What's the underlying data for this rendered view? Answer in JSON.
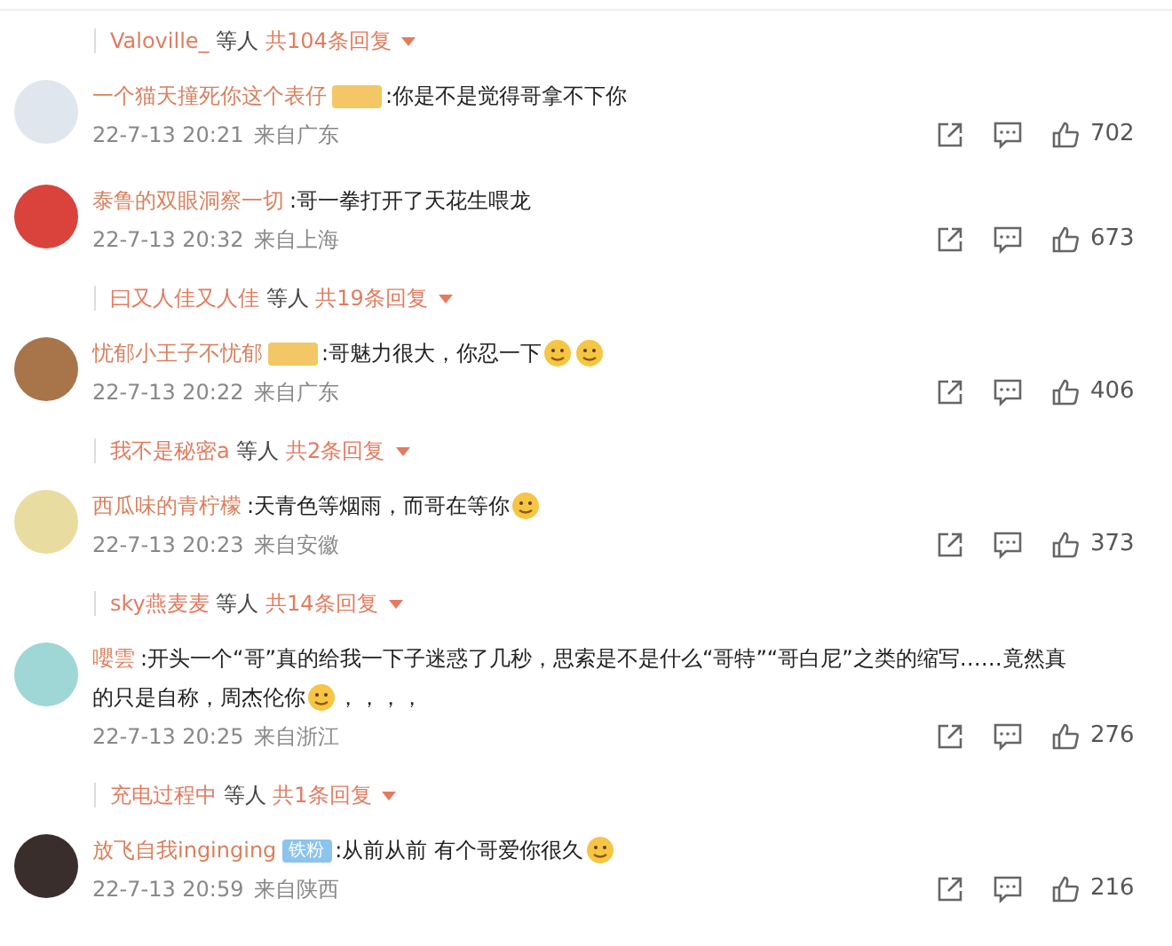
{
  "items": [
    {
      "kind": "reply_summary",
      "user": "Valoville_",
      "others": "等人",
      "count": "共104条回复"
    },
    {
      "kind": "comment",
      "avatar": {
        "color": "#dfe6ee"
      },
      "user": "一个猫天撞死你这个表仔",
      "badge": {
        "color": "#f3c766"
      },
      "content": [
        {
          "kind": "text",
          "text": ":你是不是觉得哥拿不下你"
        }
      ],
      "time": "22-7-13 20:21",
      "location": "来自广东",
      "likes": "702"
    },
    {
      "kind": "comment",
      "avatar": {
        "color": "#d9433b"
      },
      "user": "泰鲁的双眼洞察一切",
      "content": [
        {
          "kind": "text",
          "text": ":哥一拳打开了天花生喂龙"
        }
      ],
      "time": "22-7-13 20:32",
      "location": "来自上海",
      "likes": "673"
    },
    {
      "kind": "reply_summary",
      "user": "曰又人佳又人佳",
      "others": "等人",
      "count": "共19条回复"
    },
    {
      "kind": "comment",
      "avatar": {
        "color": "#a8744a"
      },
      "user": "忧郁小王子不忧郁",
      "badge": {
        "color": "#f3c766"
      },
      "content": [
        {
          "kind": "text",
          "text": ":哥魅力很大，你忍一下"
        },
        {
          "kind": "emoji"
        },
        {
          "kind": "emoji"
        }
      ],
      "time": "22-7-13 20:22",
      "location": "来自广东",
      "likes": "406"
    },
    {
      "kind": "reply_summary",
      "user": "我不是秘密a",
      "others": "等人",
      "count": "共2条回复"
    },
    {
      "kind": "comment",
      "avatar": {
        "color": "#e9dca0"
      },
      "user": "西瓜味的青柠檬",
      "content": [
        {
          "kind": "text",
          "text": ":天青色等烟雨，而哥在等你"
        },
        {
          "kind": "emoji"
        }
      ],
      "time": "22-7-13 20:23",
      "location": "来自安徽",
      "likes": "373"
    },
    {
      "kind": "reply_summary",
      "user": "sky燕麦麦",
      "others": "等人",
      "count": "共14条回复"
    },
    {
      "kind": "comment",
      "avatar": {
        "color": "#9fd6d6"
      },
      "user": "嚶雲",
      "content": [
        {
          "kind": "text",
          "text": ":开头一个“哥”真的给我一下子迷惑了几秒，思索是不是什么“哥特”“哥白尼”之类的缩写……竟然真"
        },
        {
          "kind": "text",
          "text": "的只是自称，周杰伦你"
        },
        {
          "kind": "emoji"
        },
        {
          "kind": "text",
          "text": "，，，，"
        }
      ],
      "time": "22-7-13 20:25",
      "location": "来自浙江",
      "likes": "276"
    },
    {
      "kind": "reply_summary",
      "user": "充电过程中",
      "others": "等人",
      "count": "共1条回复"
    },
    {
      "kind": "comment",
      "avatar": {
        "color": "#3a2e2c"
      },
      "user": "放飞自我inginging",
      "badge": {
        "color": "#8cc4ee",
        "text": "铁粉"
      },
      "content": [
        {
          "kind": "text",
          "text": ":从前从前 有个哥爱你很久"
        },
        {
          "kind": "emoji"
        }
      ],
      "time": "22-7-13 20:59",
      "location": "来自陕西",
      "likes": "216"
    }
  ]
}
